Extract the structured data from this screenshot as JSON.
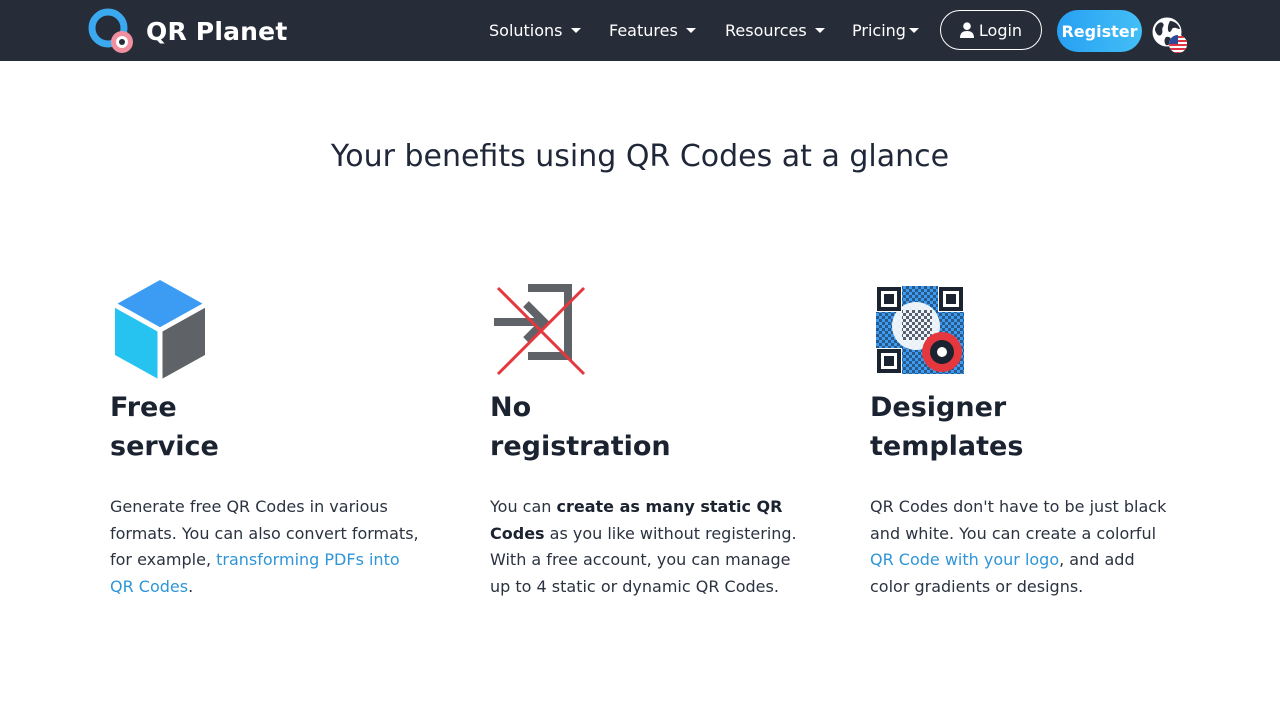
{
  "header": {
    "brand": "QR Planet",
    "nav": [
      {
        "label": "Solutions"
      },
      {
        "label": "Features"
      },
      {
        "label": "Resources"
      },
      {
        "label": "Pricing"
      }
    ],
    "login_label": "Login",
    "register_label": "Register"
  },
  "main": {
    "headline": "Your benefits using QR Codes at a glance",
    "features": [
      {
        "title_line1": "Free",
        "title_line2": "service",
        "text_prefix": "Generate free QR Codes in various formats. You can also convert formats, for example, ",
        "link_text": "transforming PDFs into QR Codes",
        "text_suffix": "."
      },
      {
        "title_line1": "No",
        "title_line2": "registration",
        "text_prefix": "You can ",
        "bold_text": "create as many static QR Codes",
        "text_suffix": " as you like without registering. With a free account, you can manage up to 4 static or dynamic QR Codes."
      },
      {
        "title_line1": "Designer",
        "title_line2": "templates",
        "text_prefix": "QR Codes don't have to be just black and white. You can create a colorful ",
        "link_text": "QR Code with your logo",
        "text_suffix": ", and add color gradients or designs."
      }
    ]
  },
  "colors": {
    "header_bg": "#262d38",
    "accent": "#2f95d7",
    "register_bg": "#35b0f4"
  }
}
